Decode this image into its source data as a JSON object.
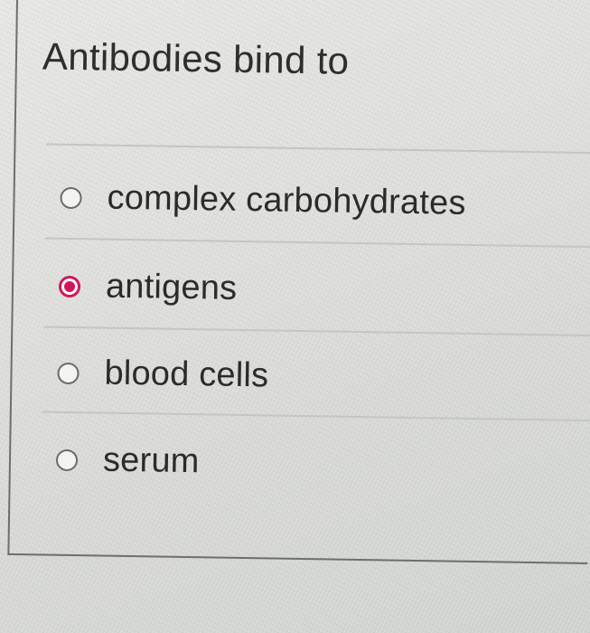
{
  "question": {
    "text": "Antibodies bind to"
  },
  "options": [
    {
      "label": "complex carbohydrates",
      "selected": false
    },
    {
      "label": "antigens",
      "selected": true
    },
    {
      "label": "blood cells",
      "selected": false
    },
    {
      "label": "serum",
      "selected": false
    }
  ],
  "colors": {
    "selected_accent": "#d2165e",
    "radio_border": "#6a6a6a",
    "text": "#2b2b2b"
  }
}
